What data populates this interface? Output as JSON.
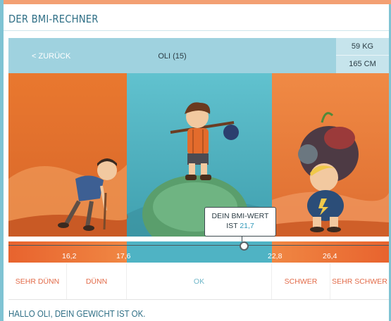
{
  "header": {
    "title": "DER BMI-RECHNER"
  },
  "nav": {
    "back_label": "< ZURÜCK",
    "user": "OLI (15)"
  },
  "stats": {
    "weight": "59 KG",
    "height": "165 CM"
  },
  "result": {
    "bubble_line1": "DEIN BMI-WERT",
    "bubble_prefix": "IST",
    "bmi_value": "21,7"
  },
  "scale": {
    "min": 13.5,
    "max": 30,
    "current": 21.7,
    "thresholds": [
      "16,2",
      "17,6",
      "22,8",
      "26,4"
    ]
  },
  "categories": [
    "SEHR DÜNN",
    "DÜNN",
    "OK",
    "SCHWER",
    "SEHR SCHWER"
  ],
  "message": "HALLO OLI, DEIN GEWICHT IST OK.",
  "colors": {
    "accent": "#2f6f86",
    "ok_zone": "#4fb3c4",
    "warn_zone": "#e56a3c",
    "label_warn": "#e26a48"
  }
}
